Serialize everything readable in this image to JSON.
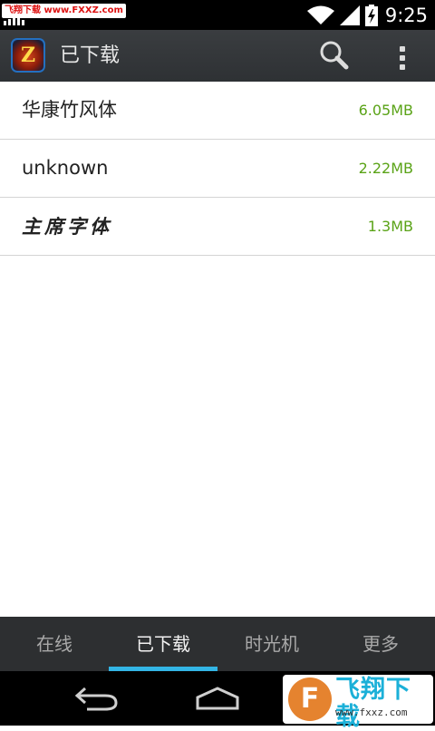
{
  "status_bar": {
    "watermark": "飞翔下载 www.FXXZ.com",
    "time": "9:25",
    "icons": [
      "wifi-icon",
      "signal-icon",
      "battery-charging-icon"
    ]
  },
  "action_bar": {
    "title": "已下载",
    "icons": [
      "app-logo",
      "search-icon",
      "overflow-menu-icon"
    ],
    "app_icon_letter": "Z"
  },
  "downloads": [
    {
      "name": "华康竹风体",
      "size": "6.05MB"
    },
    {
      "name": "unknown",
      "size": "2.22MB"
    },
    {
      "name": "主席字体",
      "size": "1.3MB"
    }
  ],
  "tabs": [
    {
      "label": "在线",
      "active": false
    },
    {
      "label": "已下载",
      "active": true
    },
    {
      "label": "时光机",
      "active": false
    },
    {
      "label": "更多",
      "active": false
    }
  ],
  "nav_bar": {
    "icons": [
      "back-icon",
      "home-icon"
    ]
  },
  "watermark_logo": {
    "glyph": "F",
    "text": "飞翔下载",
    "url": "www.fxxz.com"
  },
  "colors": {
    "size_text": "#5aa317",
    "tab_indicator": "#33b5e5",
    "action_bar": "#35383b"
  }
}
